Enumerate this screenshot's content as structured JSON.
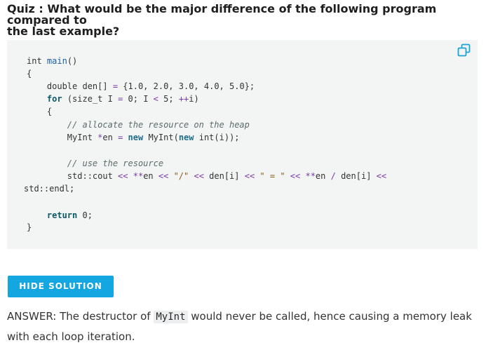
{
  "quiz": {
    "title": "Quiz : What would be the major difference of the following program compared to\nthe last example?"
  },
  "code": {
    "copy_icon": "copy-icon",
    "lines": [
      [
        {
          "t": "int ",
          "c": "plain"
        },
        {
          "t": "main",
          "c": "func"
        },
        {
          "t": "()",
          "c": "plain"
        }
      ],
      [
        {
          "t": "{",
          "c": "plain"
        }
      ],
      [
        {
          "t": "    double den[] ",
          "c": "plain"
        },
        {
          "t": "=",
          "c": "op"
        },
        {
          "t": " {1.0, 2.0, 3.0, 4.0, 5.0};",
          "c": "plain"
        }
      ],
      [
        {
          "t": "    ",
          "c": "plain"
        },
        {
          "t": "for",
          "c": "kw"
        },
        {
          "t": " (size_t I ",
          "c": "plain"
        },
        {
          "t": "=",
          "c": "op"
        },
        {
          "t": " 0; I ",
          "c": "plain"
        },
        {
          "t": "<",
          "c": "op"
        },
        {
          "t": " 5; ",
          "c": "plain"
        },
        {
          "t": "++",
          "c": "op"
        },
        {
          "t": "i)",
          "c": "plain"
        }
      ],
      [
        {
          "t": "    {",
          "c": "plain"
        }
      ],
      [
        {
          "t": "        ",
          "c": "plain"
        },
        {
          "t": "// allocate the resource on the heap",
          "c": "comment"
        }
      ],
      [
        {
          "t": "        MyInt ",
          "c": "plain"
        },
        {
          "t": "*",
          "c": "op"
        },
        {
          "t": "en ",
          "c": "plain"
        },
        {
          "t": "=",
          "c": "op"
        },
        {
          "t": " ",
          "c": "plain"
        },
        {
          "t": "new",
          "c": "new"
        },
        {
          "t": " MyInt(",
          "c": "plain"
        },
        {
          "t": "new",
          "c": "new"
        },
        {
          "t": " int(i));",
          "c": "plain"
        }
      ],
      [],
      [
        {
          "t": "        ",
          "c": "plain"
        },
        {
          "t": "// use the resource",
          "c": "comment"
        }
      ],
      [
        {
          "t": "        std::cout ",
          "c": "plain"
        },
        {
          "t": "<<",
          "c": "op"
        },
        {
          "t": " ",
          "c": "plain"
        },
        {
          "t": "**",
          "c": "op"
        },
        {
          "t": "en ",
          "c": "plain"
        },
        {
          "t": "<<",
          "c": "op"
        },
        {
          "t": " ",
          "c": "plain"
        },
        {
          "t": "\"/\"",
          "c": "str"
        },
        {
          "t": " ",
          "c": "plain"
        },
        {
          "t": "<<",
          "c": "op"
        },
        {
          "t": " den[i] ",
          "c": "plain"
        },
        {
          "t": "<<",
          "c": "op"
        },
        {
          "t": " ",
          "c": "plain"
        },
        {
          "t": "\" = \"",
          "c": "str"
        },
        {
          "t": " ",
          "c": "plain"
        },
        {
          "t": "<<",
          "c": "op"
        },
        {
          "t": " ",
          "c": "plain"
        },
        {
          "t": "**",
          "c": "op"
        },
        {
          "t": "en ",
          "c": "plain"
        },
        {
          "t": "/",
          "c": "op"
        },
        {
          "t": " den[i] ",
          "c": "plain"
        },
        {
          "t": "<<",
          "c": "op"
        }
      ],
      [
        {
          "t": "std::endl;",
          "c": "plain"
        }
      ],
      [],
      [],
      [
        {
          "t": "    ",
          "c": "plain"
        },
        {
          "t": "return",
          "c": "kw"
        },
        {
          "t": " 0;",
          "c": "plain"
        }
      ],
      [
        {
          "t": "}",
          "c": "plain"
        }
      ]
    ]
  },
  "solution": {
    "button_label": "HIDE SOLUTION",
    "answer_prefix": "ANSWER: The destructor of ",
    "answer_code": "MyInt",
    "answer_suffix": " would never be called, hence causing a memory leak with each loop iteration."
  }
}
